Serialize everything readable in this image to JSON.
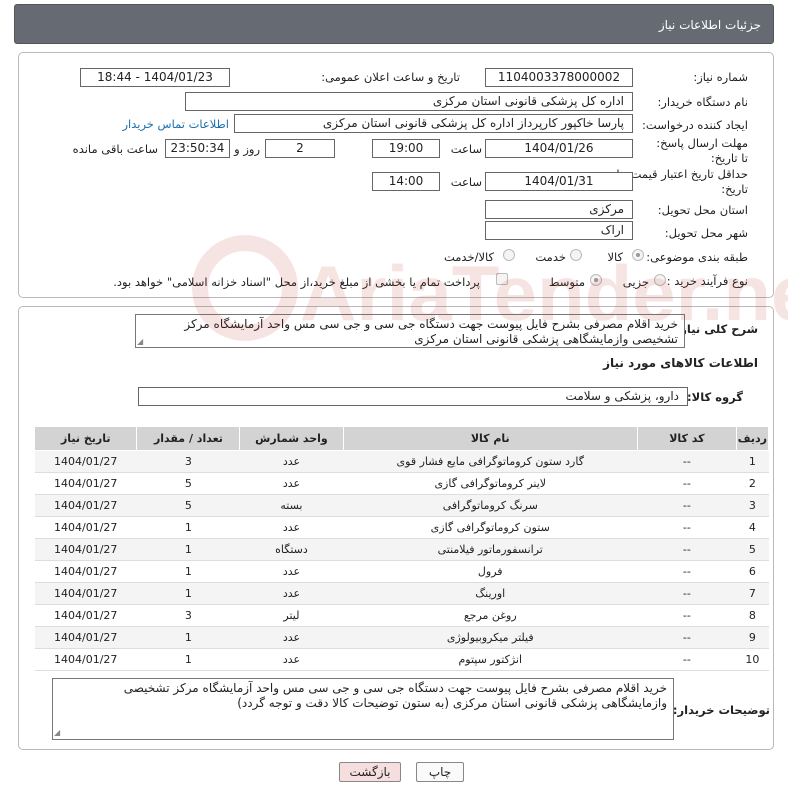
{
  "header": {
    "title": "جزئیات اطلاعات نیاز"
  },
  "form": {
    "need_number_label": "شماره نیاز:",
    "need_number": "1104003378000002",
    "announce_label": "تاریخ و ساعت اعلان عمومی:",
    "announce_value": "1404/01/23 - 18:44",
    "buyer_label": "نام دستگاه خریدار:",
    "buyer_value": "اداره کل پزشکی قانونی استان مرکزی",
    "creator_label": "ایجاد کننده درخواست:",
    "creator_value": "پارسا خاکپور کارپرداز اداره کل پزشکی قانونی استان مرکزی",
    "contact_link": "اطلاعات تماس خریدار",
    "deadline_label": "مهلت ارسال پاسخ: تا تاریخ:",
    "deadline_date": "1404/01/26",
    "time_label": "ساعت",
    "deadline_time": "19:00",
    "days_value": "2",
    "days_label": "روز و",
    "remaining_time": "23:50:34",
    "remaining_label": "ساعت باقی مانده",
    "validity_label": "حداقل تاریخ اعتبار قیمت: تا تاریخ:",
    "validity_date": "1404/01/31",
    "validity_time": "14:00",
    "province_label": "استان محل تحویل:",
    "province_value": "مرکزی",
    "city_label": "شهر محل تحویل:",
    "city_value": "اراک",
    "category_label": "طبقه بندی موضوعی:",
    "category_options": [
      "کالا",
      "خدمت",
      "کالا/خدمت"
    ],
    "category_selected": "کالا",
    "process_label": "نوع فرآیند خرید :",
    "process_options": [
      "جزیی",
      "متوسط"
    ],
    "process_selected": "متوسط",
    "payment_note": "پرداخت تمام یا بخشی از مبلغ خرید،از محل \"اسناد خزانه اسلامی\" خواهد بود."
  },
  "description": {
    "label": "شرح کلی نیاز:",
    "text": "خرید اقلام مصرفی بشرح فایل پیوست جهت دستگاه جی سی و جی سی مس واحد آزمایشگاه مرکز تشخیصی وازمایشگاهی پزشکی قانونی استان مرکزی"
  },
  "goods": {
    "section_title": "اطلاعات کالاهای مورد نیاز",
    "group_label": "گروه کالا:",
    "group_value": "دارو، پزشکی و سلامت",
    "columns": [
      "ردیف",
      "کد کالا",
      "نام کالا",
      "واحد شمارش",
      "تعداد / مقدار",
      "تاریخ نیاز"
    ],
    "rows": [
      [
        "1",
        "--",
        "گارد ستون کروماتوگرافی مایع فشار قوی",
        "عدد",
        "3",
        "1404/01/27"
      ],
      [
        "2",
        "--",
        "لاینر کروماتوگرافی گازی",
        "عدد",
        "5",
        "1404/01/27"
      ],
      [
        "3",
        "--",
        "سرنگ کروماتوگرافی",
        "بسته",
        "5",
        "1404/01/27"
      ],
      [
        "4",
        "--",
        "ستون کروماتوگرافی گازی",
        "عدد",
        "1",
        "1404/01/27"
      ],
      [
        "5",
        "--",
        "ترانسفورماتور فیلامنتی",
        "دستگاه",
        "1",
        "1404/01/27"
      ],
      [
        "6",
        "--",
        "فرول",
        "عدد",
        "1",
        "1404/01/27"
      ],
      [
        "7",
        "--",
        "اورینگ",
        "عدد",
        "1",
        "1404/01/27"
      ],
      [
        "8",
        "--",
        "روغن مرجع",
        "لیتر",
        "3",
        "1404/01/27"
      ],
      [
        "9",
        "--",
        "فیلتر میکروبیولوژی",
        "عدد",
        "1",
        "1404/01/27"
      ],
      [
        "10",
        "--",
        "انژکتور سپتوم",
        "عدد",
        "1",
        "1404/01/27"
      ]
    ]
  },
  "buyer_notes": {
    "label": "توضیحات خریدار:",
    "text": "خرید اقلام مصرفی بشرح فایل پیوست جهت دستگاه جی سی و جی سی مس واحد آزمایشگاه مرکز تشخیصی وازمایشگاهی پزشکی قانونی استان مرکزی (به ستون توضیحات کالا دقت و توجه گردد)"
  },
  "buttons": {
    "print": "چاپ",
    "back": "بازگشت"
  },
  "watermark": {
    "text": "AriaTender.neT"
  },
  "colors": {
    "titlebar": "#666a73",
    "link": "#1a6fb0",
    "back_button": "#f7dede",
    "watermark": "#c0392b"
  }
}
